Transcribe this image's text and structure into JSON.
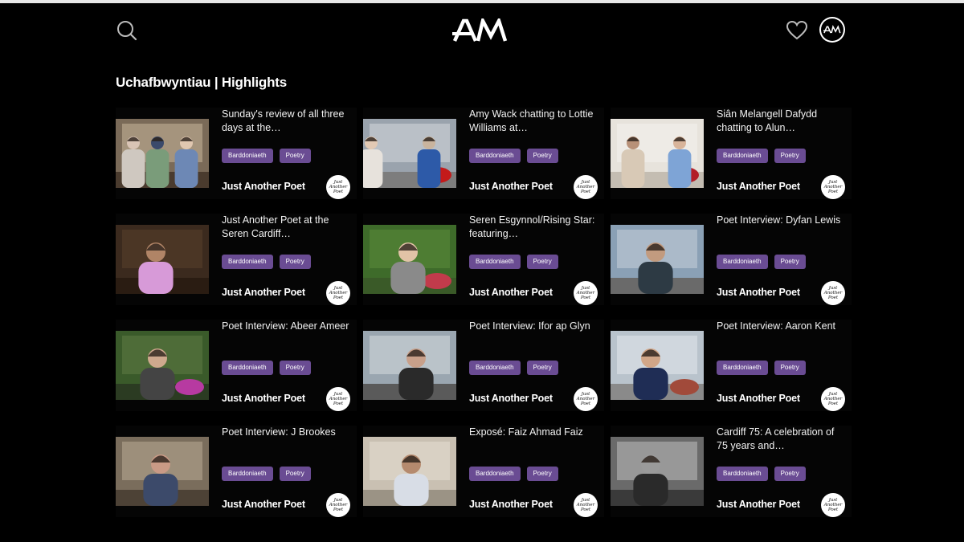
{
  "header": {
    "logo_text": "AM",
    "avatar_text": "AM",
    "search_icon": "search-icon",
    "heart_icon": "heart-icon"
  },
  "page_title": "Uchafbwyntiau | Highlights",
  "tag_labels": {
    "tag1": "Barddoniaeth",
    "tag2": "Poetry"
  },
  "author": "Just Another Poet",
  "author_badge": "Just Another Poet",
  "colors": {
    "tag_bg": "#6a4c93",
    "background": "#000000",
    "text": "#ffffff"
  },
  "cards": [
    {
      "title": "Sunday's review of all three days at the…"
    },
    {
      "title": "Amy Wack chatting to Lottie Williams at…"
    },
    {
      "title": "Siân Melangell Dafydd chatting to Alun…"
    },
    {
      "title": "Just Another Poet at the Seren Cardiff…"
    },
    {
      "title": "Seren Esgynnol/Rising Star: featuring…"
    },
    {
      "title": "Poet Interview: Dyfan Lewis"
    },
    {
      "title": "Poet Interview: Abeer Ameer"
    },
    {
      "title": "Poet Interview: Ifor ap Glyn"
    },
    {
      "title": "Poet Interview: Aaron Kent"
    },
    {
      "title": "Poet Interview: J Brookes"
    },
    {
      "title": "Exposé: Faiz Ahmad Faiz"
    },
    {
      "title": "Cardiff 75: A celebration of 75 years and…"
    }
  ]
}
